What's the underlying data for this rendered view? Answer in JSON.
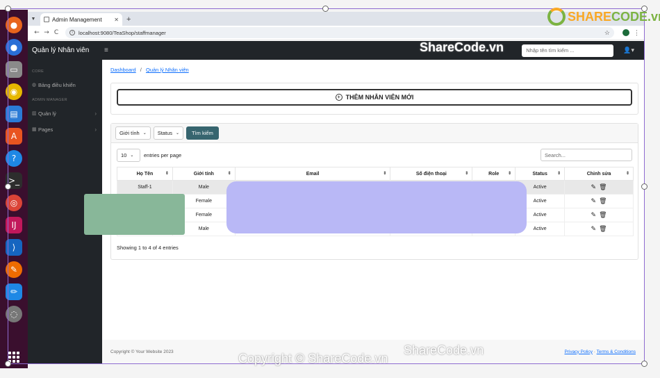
{
  "browser": {
    "tab_title": "Admin Management",
    "new_tab": "+",
    "url": "localhost:9080/TeaShop/staffmanager",
    "back": "←",
    "forward": "→",
    "reload": "C"
  },
  "app": {
    "brand": "Quản lý Nhân viên",
    "menu_icon": "≡",
    "search_placeholder": "Nhập tên tìm kiếm ...",
    "user_icon": "👤▾"
  },
  "sidebar": {
    "section_core": "CORE",
    "dashboard": "Bảng điều khiển",
    "section_admin": "ADMIN MANAGER",
    "manage": "Quản lý",
    "pages": "Pages"
  },
  "breadcrumb": {
    "home": "Dashboard",
    "sep": "/",
    "current": "Quản lý Nhân viên"
  },
  "add_button": "THÊM NHÂN VIÊN MỚI",
  "filters": {
    "gender": "Giới tính",
    "status": "Status",
    "search_button": "Tìm kiếm"
  },
  "table_controls": {
    "page_size": "10",
    "entries_label": "entries per page",
    "search_placeholder": "Search..."
  },
  "table": {
    "headers": [
      "Họ Tên",
      "Giới tính",
      "Email",
      "Số điện thoại",
      "Role",
      "Status",
      "Chỉnh sửa"
    ],
    "rows": [
      {
        "name": "Staff-1",
        "gender": "Male",
        "status": "Active"
      },
      {
        "name": "",
        "gender": "Female",
        "status": "Active"
      },
      {
        "name": "",
        "gender": "Female",
        "status": "Active"
      },
      {
        "name": "",
        "gender": "Male",
        "status": "Active"
      }
    ]
  },
  "showing": "Showing 1 to 4 of 4 entries",
  "footer": {
    "copyright": "Copyright © Your Website 2023",
    "privacy": "Privacy Policy",
    "dot": " · ",
    "terms": "Terms & Conditions"
  },
  "watermarks": {
    "top": "ShareCode.vn",
    "bottom": "ShareCode.vn",
    "copyright": "Copyright © ShareCode.vn",
    "logo_a": "SHARE",
    "logo_b": "CODE.vn"
  }
}
